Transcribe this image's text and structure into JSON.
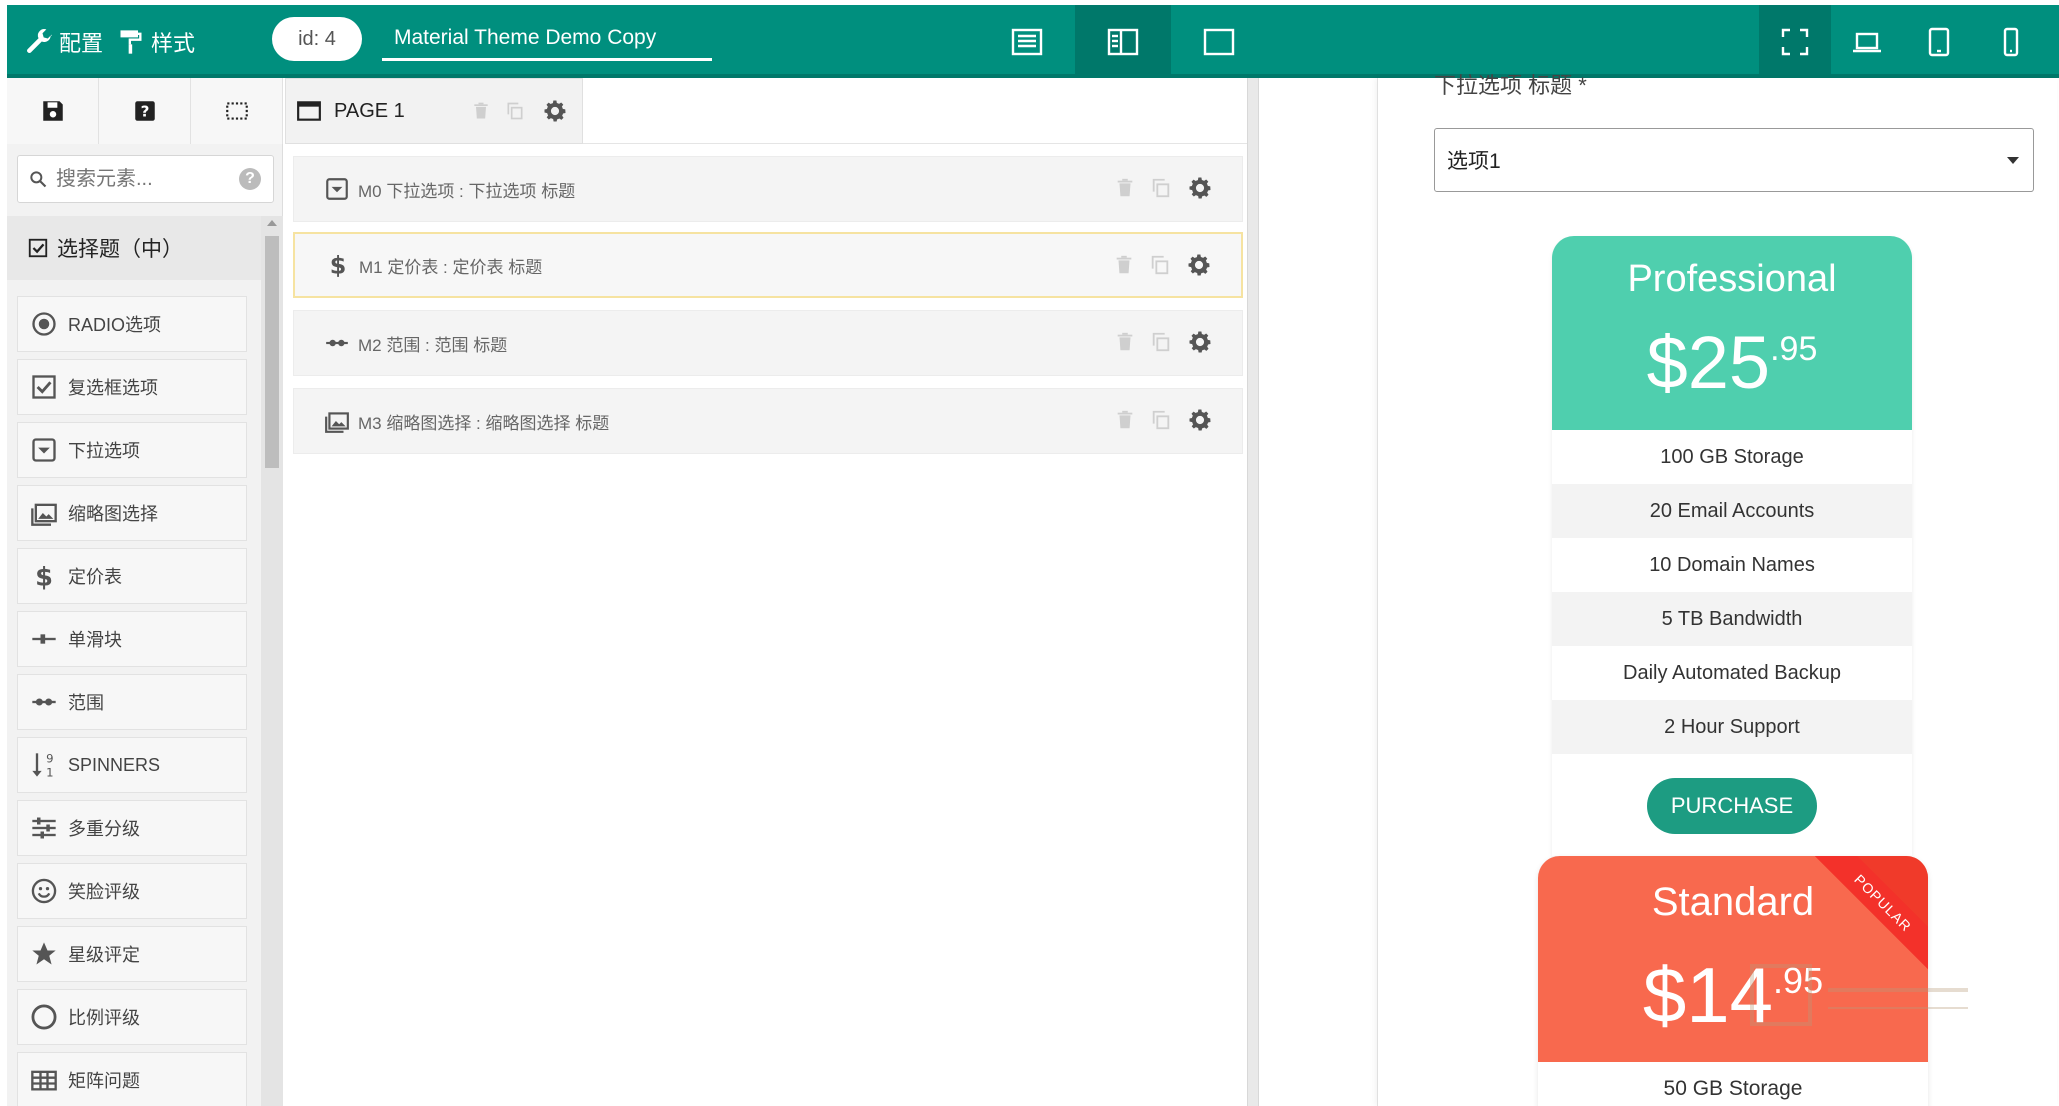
{
  "topbar": {
    "config_label": "配置",
    "style_label": "样式",
    "id_label": "id: 4",
    "doc_title": "Material Theme Demo Copy"
  },
  "sidebar": {
    "search_placeholder": "搜索元素...",
    "group_title": "选择题（中）",
    "items": [
      {
        "label": "RADIO选项",
        "icon": "radio-icon"
      },
      {
        "label": "复选框选项",
        "icon": "checkbox-icon"
      },
      {
        "label": "下拉选项",
        "icon": "dropdown-icon"
      },
      {
        "label": "缩略图选择",
        "icon": "image-icon"
      },
      {
        "label": "定价表",
        "icon": "dollar-icon"
      },
      {
        "label": "单滑块",
        "icon": "slider-icon"
      },
      {
        "label": "范围",
        "icon": "range-icon"
      },
      {
        "label": "SPINNERS",
        "icon": "spinner-icon"
      },
      {
        "label": "多重分级",
        "icon": "sliders-icon"
      },
      {
        "label": "笑脸评级",
        "icon": "smiley-icon"
      },
      {
        "label": "星级评定",
        "icon": "star-icon"
      },
      {
        "label": "比例评级",
        "icon": "circle-icon"
      },
      {
        "label": "矩阵问题",
        "icon": "table-icon"
      }
    ]
  },
  "builder": {
    "page_label": "PAGE 1",
    "questions": [
      {
        "text": "M0 下拉选项 : 下拉选项 标题",
        "icon": "dropdown-icon"
      },
      {
        "text": "M1 定价表 : 定价表 标题",
        "icon": "dollar-icon"
      },
      {
        "text": "M2 范围 : 范围 标题",
        "icon": "range-icon"
      },
      {
        "text": "M3 缩略图选择 : 缩略图选择 标题",
        "icon": "image-icon"
      }
    ]
  },
  "preview": {
    "question_title": "下拉选项 标题 *",
    "select_value": "选项1",
    "professional": {
      "name": "Professional",
      "price_main": "$25",
      "price_cents": ".95",
      "features": [
        "100 GB Storage",
        "20 Email Accounts",
        "10 Domain Names",
        "5 TB Bandwidth",
        "Daily Automated Backup",
        "2 Hour Support"
      ],
      "button": "PURCHASE"
    },
    "standard": {
      "name": "Standard",
      "price_main": "$14",
      "price_cents": ".95",
      "ribbon": "POPULAR",
      "features": [
        "50 GB Storage"
      ]
    }
  },
  "colors": {
    "topbar": "#008f7e",
    "professional": "#4fcfae",
    "standard": "#f8694e",
    "purchase": "#1d9c82"
  }
}
